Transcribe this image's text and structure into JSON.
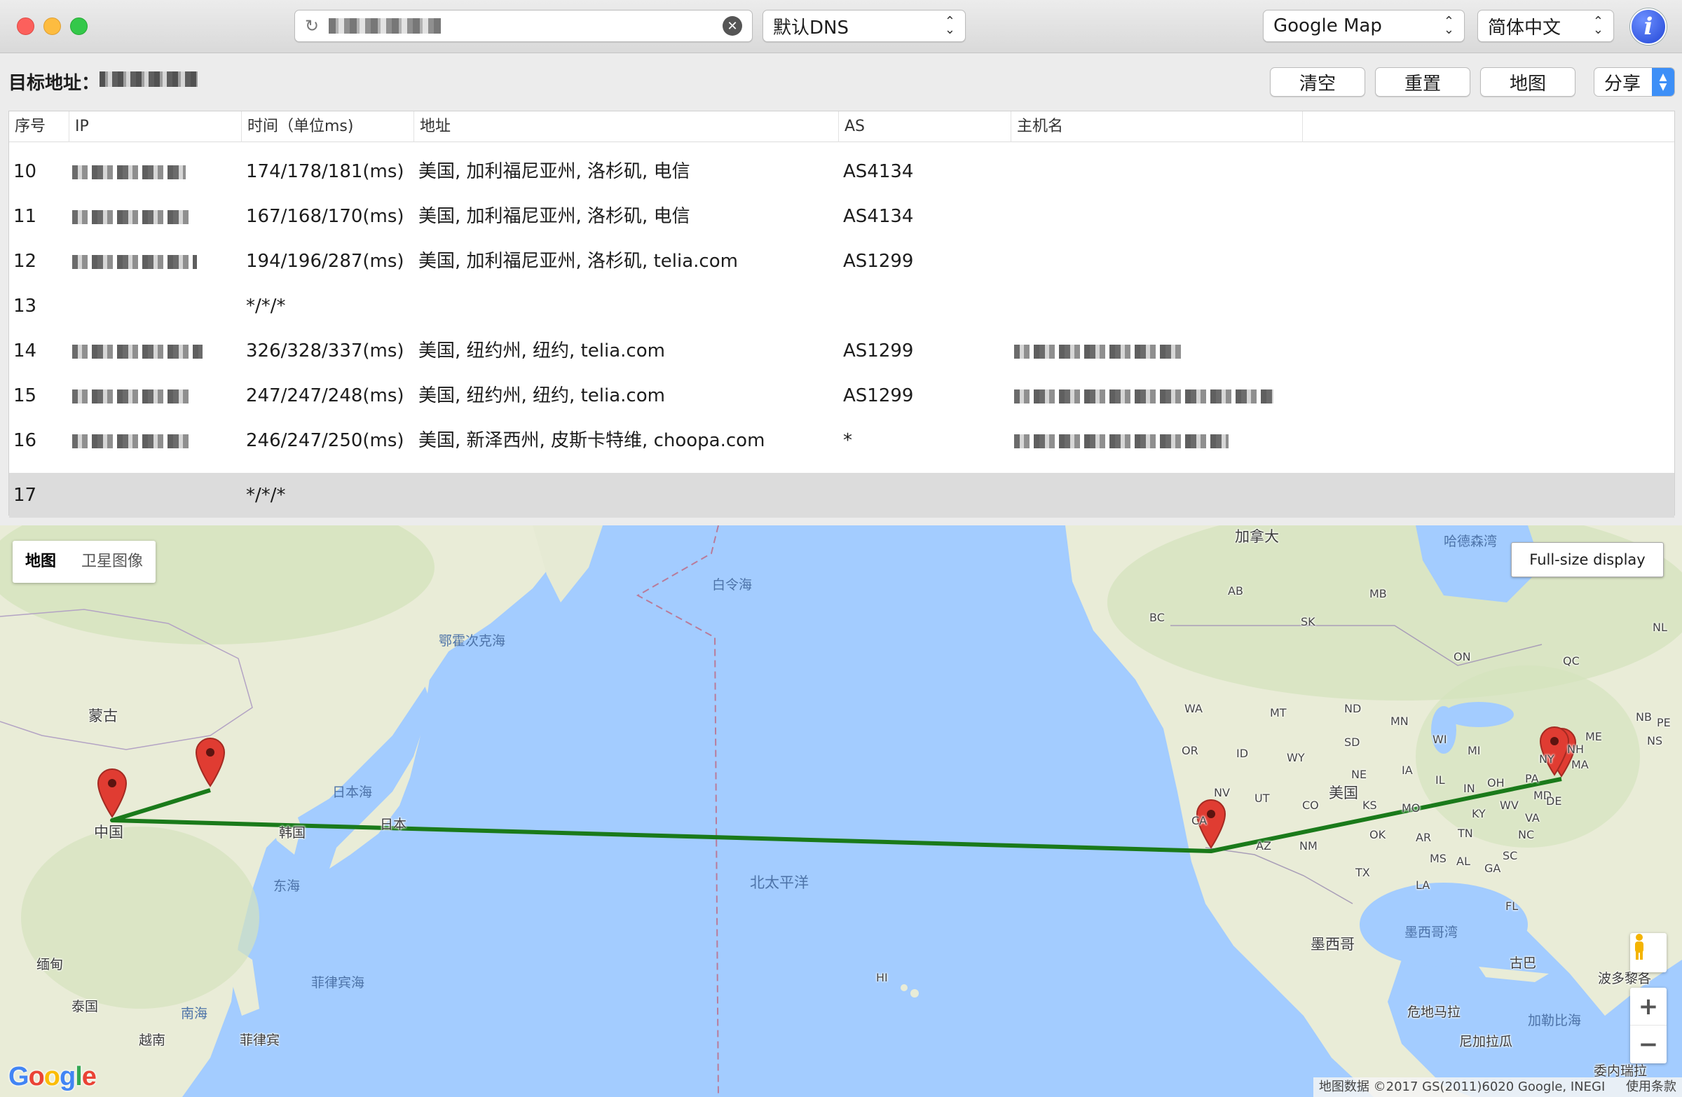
{
  "toolbar": {
    "search_placeholder": "",
    "dns_select": "默认DNS",
    "map_select": "Google Map",
    "language_select": "简体中文"
  },
  "target": {
    "label": "目标地址："
  },
  "actions": {
    "clear": "清空",
    "reset": "重置",
    "map": "地图",
    "share": "分享"
  },
  "table": {
    "columns": [
      "序号",
      "IP",
      "时间（单位ms)",
      "地址",
      "AS",
      "主机名"
    ],
    "rows": [
      {
        "no": "10",
        "time": "174/178/181(ms)",
        "address": "美国, 加利福尼亚州, 洛杉矶, 电信",
        "as": "AS4134"
      },
      {
        "no": "11",
        "time": "167/168/170(ms)",
        "address": "美国, 加利福尼亚州, 洛杉矶, 电信",
        "as": "AS4134"
      },
      {
        "no": "12",
        "time": "194/196/287(ms)",
        "address": "美国, 加利福尼亚州, 洛杉矶, telia.com",
        "as": "AS1299"
      },
      {
        "no": "13",
        "time": "*/*/*",
        "address": "",
        "as": ""
      },
      {
        "no": "14",
        "time": "326/328/337(ms)",
        "address": "美国, 纽约州, 纽约, telia.com",
        "as": "AS1299"
      },
      {
        "no": "15",
        "time": "247/247/248(ms)",
        "address": "美国, 纽约州, 纽约, telia.com",
        "as": "AS1299"
      },
      {
        "no": "16",
        "time": "246/247/250(ms)",
        "address": "美国, 新泽西州, 皮斯卡特维, choopa.com",
        "as": "*"
      },
      {
        "no": "17",
        "time": "*/*/*",
        "address": "",
        "as": ""
      }
    ],
    "selected_row": "17"
  },
  "map": {
    "type_map": "地图",
    "type_satellite": "卫星图像",
    "full_size": "Full-size display",
    "logo": "Google",
    "attribution": "地图数据 ©2017 GS(2011)6020 Google, INEGI",
    "terms": "使用条款",
    "labels": {
      "mongolia": "蒙古",
      "china": "中国",
      "korea": "韩国",
      "japan": "日本",
      "sea_of_japan": "日本海",
      "east_sea": "东海",
      "okhotsk": "鄂霍次克海",
      "bering": "白令海",
      "north_pacific": "北太平洋",
      "myanmar": "缅甸",
      "thailand": "泰国",
      "vietnam": "越南",
      "south_sea": "南海",
      "philippines": "菲律宾",
      "philippine_sea": "菲律宾海",
      "hawaii": "HI",
      "canada": "加拿大",
      "hudson": "哈德森湾",
      "usa": "美国",
      "mexico": "墨西哥",
      "gulf_mexico": "墨西哥湾",
      "cuba": "古巴",
      "puerto_rico": "波多黎各",
      "guatemala": "危地马拉",
      "nicaragua": "尼加拉瓜",
      "caribbean": "加勒比海",
      "venezuela": "委内瑞拉"
    },
    "states": [
      "WA",
      "OR",
      "ID",
      "MT",
      "ND",
      "SD",
      "MN",
      "WI",
      "MI",
      "NE",
      "IA",
      "IL",
      "IN",
      "OH",
      "PA",
      "NY",
      "WY",
      "UT",
      "CO",
      "KS",
      "MO",
      "KY",
      "WV",
      "VA",
      "MD",
      "DE",
      "NV",
      "CA",
      "AZ",
      "NM",
      "TX",
      "OK",
      "AR",
      "TN",
      "NC",
      "SC",
      "MS",
      "AL",
      "GA",
      "LA",
      "FL",
      "ME",
      "NH",
      "MA",
      "BC",
      "AB",
      "SK",
      "MB",
      "ON",
      "QC",
      "NL",
      "NB",
      "PE",
      "NS"
    ],
    "colors": {
      "route": "#1a7a1a",
      "pin": "#e03c32",
      "water": "#a3ccff",
      "land": "#e8ecd8"
    }
  }
}
